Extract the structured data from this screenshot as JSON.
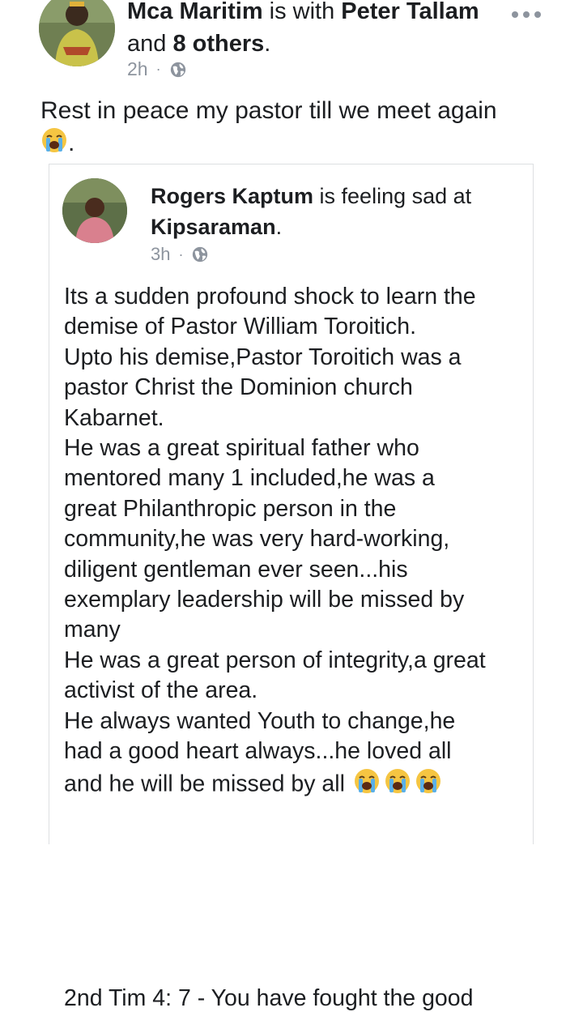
{
  "post": {
    "author": "Mca Maritim",
    "with_text": " is with ",
    "tagged": "Peter Tallam",
    "and_text": "and ",
    "others": "8 others",
    "period": ".",
    "time": "2h",
    "separator": "·",
    "privacy_icon": "globe-icon",
    "text": "Rest in peace my pastor till we meet again",
    "trailing": "."
  },
  "shared": {
    "author": "Rogers Kaptum",
    "feeling_text": " is feeling sad at",
    "place": "Kipsaraman",
    "period": ".",
    "time": "3h",
    "separator": "·",
    "privacy_icon": "globe-icon",
    "body": "Its a sudden profound shock to learn the\ndemise of Pastor William Toroitich.\nUpto his demise,Pastor Toroitich was a\npastor Christ the Dominion church\nKabarnet.\nHe was a great spiritual father who\nmentored many 1 included,he was a\ngreat Philanthropic person in the\ncommunity,he was very hard-working,\ndiligent gentleman ever seen...his\nexemplary leadership will be missed by\nmany\nHe was a great person of integrity,a great\nactivist of the area.\nHe always wanted Youth to change,he\nhad a good heart always...he loved all\nand he will be missed by all",
    "cut_off_line": "2nd Tim 4: 7 - You have fought the good"
  },
  "colors": {
    "text": "#1c1e21",
    "meta": "#8d949e",
    "border": "#dddfe2"
  }
}
